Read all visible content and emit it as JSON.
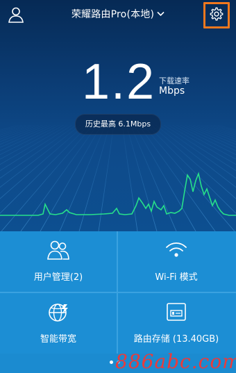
{
  "header": {
    "title": "荣耀路由Pro(本地)",
    "title_icon": "chevron-down-icon",
    "left_icon": "user-icon",
    "right_icon": "gear-icon",
    "highlight_color": "#f0781e"
  },
  "speed": {
    "value": "1.2",
    "label": "下载速率",
    "unit": "Mbps",
    "history": "历史最高 6.1Mbps"
  },
  "tiles": [
    {
      "label": "用户管理(2)",
      "icon": "users-icon"
    },
    {
      "label": "Wi-Fi 模式",
      "icon": "wifi-icon"
    },
    {
      "label": "智能带宽",
      "icon": "globe-icon"
    },
    {
      "label": "路由存储 (13.40GB)",
      "icon": "storage-icon"
    }
  ],
  "pager": {
    "pages": 2,
    "current": 1
  },
  "watermark": "886abc.com",
  "colors": {
    "tile_bg": "#1c8ed4",
    "line": "#27e08a"
  }
}
